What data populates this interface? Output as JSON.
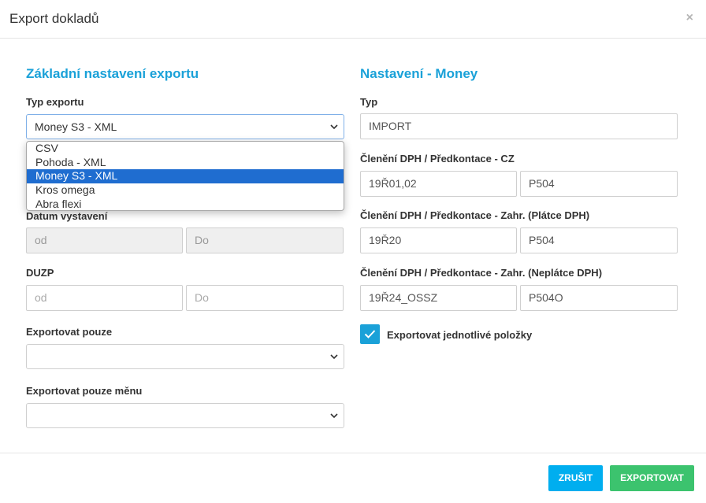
{
  "modal": {
    "title": "Export dokladů",
    "close_label": "×"
  },
  "left": {
    "section_title": "Základní nastavení exportu",
    "export_type": {
      "label": "Typ exportu",
      "value": "Money S3 - XML",
      "options": [
        "CSV",
        "Pohoda - XML",
        "Money S3 - XML",
        "Kros omega",
        "Abra flexi"
      ],
      "selected_index": 2
    },
    "issue_date": {
      "label": "Datum vystavení",
      "from_placeholder": "od",
      "to_placeholder": "Do"
    },
    "duzp": {
      "label": "DUZP",
      "from_placeholder": "od",
      "to_placeholder": "Do"
    },
    "export_only": {
      "label": "Exportovat pouze",
      "value": ""
    },
    "export_currency": {
      "label": "Exportovat pouze měnu",
      "value": ""
    }
  },
  "right": {
    "section_title": "Nastavení - Money",
    "type": {
      "label": "Typ",
      "value": "IMPORT"
    },
    "vat_cz": {
      "label": "Členění DPH / Předkontace - CZ",
      "vat": "19Ř01,02",
      "precontact": "P504"
    },
    "vat_foreign_payer": {
      "label": "Členění DPH / Předkontace - Zahr. (Plátce DPH)",
      "vat": "19Ř20",
      "precontact": "P504"
    },
    "vat_foreign_nonpayer": {
      "label": "Členění DPH / Předkontace - Zahr. (Neplátce DPH)",
      "vat": "19Ř24_OSSZ",
      "precontact": "P504O"
    },
    "export_items": {
      "label": "Exportovat jednotlivé položky",
      "checked": true
    }
  },
  "footer": {
    "cancel_label": "ZRUŠIT",
    "export_label": "EXPORTOVAT"
  },
  "colors": {
    "accent": "#1aa1d8",
    "cancel": "#00aeef",
    "export": "#3cc36e",
    "selected_option": "#1f6dd0"
  }
}
